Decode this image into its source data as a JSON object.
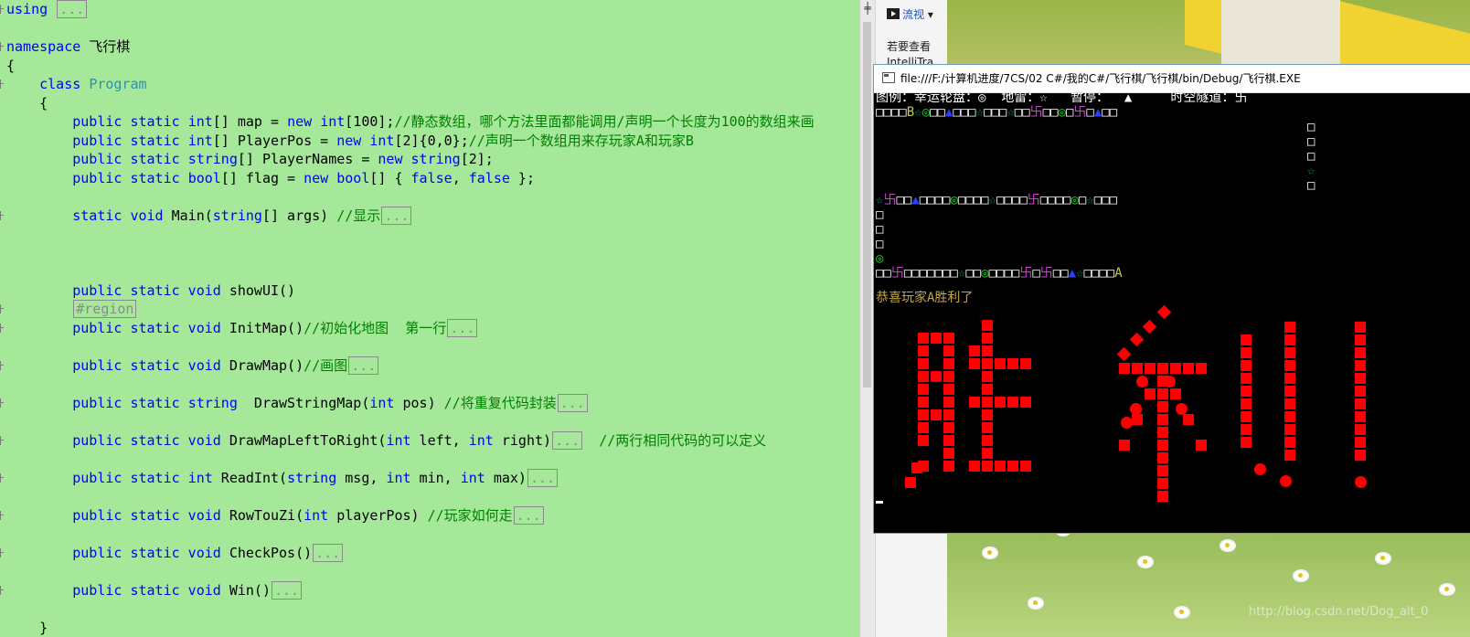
{
  "editor": {
    "lines": [
      {
        "parts": [
          {
            "t": "using",
            "c": "kw"
          },
          {
            "t": " "
          },
          {
            "t": "...",
            "c": "fold"
          }
        ]
      },
      {
        "parts": []
      },
      {
        "parts": [
          {
            "t": "namespace",
            "c": "kw"
          },
          {
            "t": " 飞行棋"
          }
        ]
      },
      {
        "parts": [
          {
            "t": "{"
          }
        ]
      },
      {
        "parts": [
          {
            "t": "    "
          },
          {
            "t": "class",
            "c": "kw"
          },
          {
            "t": " "
          },
          {
            "t": "Program",
            "c": "ty"
          }
        ]
      },
      {
        "parts": [
          {
            "t": "    {"
          }
        ]
      },
      {
        "parts": [
          {
            "t": "        "
          },
          {
            "t": "public static ",
            "c": "kw"
          },
          {
            "t": "int",
            "c": "kw"
          },
          {
            "t": "[] map = "
          },
          {
            "t": "new",
            "c": "kw"
          },
          {
            "t": " "
          },
          {
            "t": "int",
            "c": "kw"
          },
          {
            "t": "[100];"
          },
          {
            "t": "//静态数组，哪个方法里面都能调用/声明一个长度为100的数组来画",
            "c": "cm"
          }
        ]
      },
      {
        "parts": [
          {
            "t": "        "
          },
          {
            "t": "public static ",
            "c": "kw"
          },
          {
            "t": "int",
            "c": "kw"
          },
          {
            "t": "[] PlayerPos = "
          },
          {
            "t": "new",
            "c": "kw"
          },
          {
            "t": " "
          },
          {
            "t": "int",
            "c": "kw"
          },
          {
            "t": "[2]{0,0};"
          },
          {
            "t": "//声明一个数组用来存玩家A和玩家B",
            "c": "cm"
          }
        ]
      },
      {
        "parts": [
          {
            "t": "        "
          },
          {
            "t": "public static ",
            "c": "kw"
          },
          {
            "t": "string",
            "c": "kw"
          },
          {
            "t": "[] PlayerNames = "
          },
          {
            "t": "new",
            "c": "kw"
          },
          {
            "t": " "
          },
          {
            "t": "string",
            "c": "kw"
          },
          {
            "t": "[2];"
          }
        ]
      },
      {
        "parts": [
          {
            "t": "        "
          },
          {
            "t": "public static ",
            "c": "kw"
          },
          {
            "t": "bool",
            "c": "kw"
          },
          {
            "t": "[] flag = "
          },
          {
            "t": "new",
            "c": "kw"
          },
          {
            "t": " "
          },
          {
            "t": "bool",
            "c": "kw"
          },
          {
            "t": "[] { "
          },
          {
            "t": "false",
            "c": "kw"
          },
          {
            "t": ", "
          },
          {
            "t": "false",
            "c": "kw"
          },
          {
            "t": " };"
          }
        ]
      },
      {
        "parts": []
      },
      {
        "parts": [
          {
            "t": "        "
          },
          {
            "t": "static void",
            "c": "kw"
          },
          {
            "t": " Main("
          },
          {
            "t": "string",
            "c": "kw"
          },
          {
            "t": "[] args) "
          },
          {
            "t": "//显示",
            "c": "cm"
          },
          {
            "t": "...",
            "c": "fold"
          }
        ]
      },
      {
        "parts": []
      },
      {
        "parts": []
      },
      {
        "parts": []
      },
      {
        "parts": [
          {
            "t": "        "
          },
          {
            "t": "public static void",
            "c": "kw"
          },
          {
            "t": " showUI()"
          }
        ]
      },
      {
        "parts": [
          {
            "t": "        "
          },
          {
            "t": "#region",
            "c": "fold"
          }
        ]
      },
      {
        "parts": [
          {
            "t": "        "
          },
          {
            "t": "public static void",
            "c": "kw"
          },
          {
            "t": " InitMap()"
          },
          {
            "t": "//初始化地图  第一行",
            "c": "cm"
          },
          {
            "t": "...",
            "c": "fold"
          }
        ]
      },
      {
        "parts": []
      },
      {
        "parts": [
          {
            "t": "        "
          },
          {
            "t": "public static void",
            "c": "kw"
          },
          {
            "t": " DrawMap()"
          },
          {
            "t": "//画图",
            "c": "cm"
          },
          {
            "t": "...",
            "c": "fold"
          }
        ]
      },
      {
        "parts": []
      },
      {
        "parts": [
          {
            "t": "        "
          },
          {
            "t": "public static ",
            "c": "kw"
          },
          {
            "t": "string",
            "c": "kw"
          },
          {
            "t": "  DrawStringMap("
          },
          {
            "t": "int",
            "c": "kw"
          },
          {
            "t": " pos) "
          },
          {
            "t": "//将重复代码封装",
            "c": "cm"
          },
          {
            "t": "...",
            "c": "fold"
          }
        ]
      },
      {
        "parts": []
      },
      {
        "parts": [
          {
            "t": "        "
          },
          {
            "t": "public static void",
            "c": "kw"
          },
          {
            "t": " DrawMapLeftToRight("
          },
          {
            "t": "int",
            "c": "kw"
          },
          {
            "t": " left, "
          },
          {
            "t": "int",
            "c": "kw"
          },
          {
            "t": " right)"
          },
          {
            "t": "...",
            "c": "fold"
          },
          {
            "t": "  "
          },
          {
            "t": "//两行相同代码的可以定义",
            "c": "cm"
          }
        ]
      },
      {
        "parts": []
      },
      {
        "parts": [
          {
            "t": "        "
          },
          {
            "t": "public static ",
            "c": "kw"
          },
          {
            "t": "int",
            "c": "kw"
          },
          {
            "t": " ReadInt("
          },
          {
            "t": "string",
            "c": "kw"
          },
          {
            "t": " msg, "
          },
          {
            "t": "int",
            "c": "kw"
          },
          {
            "t": " min, "
          },
          {
            "t": "int",
            "c": "kw"
          },
          {
            "t": " max)"
          },
          {
            "t": "...",
            "c": "fold"
          }
        ]
      },
      {
        "parts": []
      },
      {
        "parts": [
          {
            "t": "        "
          },
          {
            "t": "public static void",
            "c": "kw"
          },
          {
            "t": " RowTouZi("
          },
          {
            "t": "int",
            "c": "kw"
          },
          {
            "t": " playerPos) "
          },
          {
            "t": "//玩家如何走",
            "c": "cm"
          },
          {
            "t": "...",
            "c": "fold"
          }
        ]
      },
      {
        "parts": []
      },
      {
        "parts": [
          {
            "t": "        "
          },
          {
            "t": "public static void",
            "c": "kw"
          },
          {
            "t": " CheckPos()"
          },
          {
            "t": "...",
            "c": "fold"
          }
        ]
      },
      {
        "parts": []
      },
      {
        "parts": [
          {
            "t": "        "
          },
          {
            "t": "public static void",
            "c": "kw"
          },
          {
            "t": " Win()"
          },
          {
            "t": "...",
            "c": "fold"
          }
        ]
      },
      {
        "parts": []
      },
      {
        "parts": [
          {
            "t": "    }"
          }
        ]
      }
    ]
  },
  "side_panel": {
    "stream_button": "流视",
    "hint_text": "若要查看",
    "hint_text2": "IntelliTra"
  },
  "console": {
    "title": "file:///F:/计算机进度/7CS/02 C#/我的C#/飞行棋/飞行棋/bin/Debug/飞行棋.EXE",
    "legend": "图例：幸运轮盘：◎  地雷：☆   暂停：  ▲     时空隧道：卐",
    "map_rows": [
      {
        "parts": [
          {
            "t": "□□□□",
            "c": "w"
          },
          {
            "t": "B",
            "c": "y"
          },
          {
            "t": "☆",
            "c": "c"
          },
          {
            "t": "◎",
            "c": "g"
          },
          {
            "t": "□□",
            "c": "w"
          },
          {
            "t": "▲",
            "c": "b"
          },
          {
            "t": "□□□",
            "c": "w"
          },
          {
            "t": "☆",
            "c": "c"
          },
          {
            "t": "□□□",
            "c": "w"
          },
          {
            "t": "☆",
            "c": "c"
          },
          {
            "t": "□□",
            "c": "w"
          },
          {
            "t": "卐",
            "c": "m"
          },
          {
            "t": "□□",
            "c": "w"
          },
          {
            "t": "◎",
            "c": "g"
          },
          {
            "t": "□",
            "c": "w"
          },
          {
            "t": "卐",
            "c": "m"
          },
          {
            "t": "□",
            "c": "w"
          },
          {
            "t": "▲",
            "c": "b"
          },
          {
            "t": "□□",
            "c": "w"
          }
        ]
      },
      {
        "parts": [
          {
            "t": "                                                        □",
            "c": "w"
          }
        ]
      },
      {
        "parts": [
          {
            "t": "                                                        □",
            "c": "w"
          }
        ]
      },
      {
        "parts": [
          {
            "t": "                                                        □",
            "c": "w"
          }
        ]
      },
      {
        "parts": [
          {
            "t": "                                                        ",
            "c": "w"
          },
          {
            "t": "☆",
            "c": "c"
          }
        ]
      },
      {
        "parts": [
          {
            "t": "                                                        □",
            "c": "w"
          }
        ]
      },
      {
        "parts": [
          {
            "t": "☆",
            "c": "c"
          },
          {
            "t": "卐",
            "c": "m"
          },
          {
            "t": "□□",
            "c": "w"
          },
          {
            "t": "▲",
            "c": "b"
          },
          {
            "t": "□□□□",
            "c": "w"
          },
          {
            "t": "◎",
            "c": "g"
          },
          {
            "t": "□□□□",
            "c": "w"
          },
          {
            "t": "☆",
            "c": "c"
          },
          {
            "t": "□□□□",
            "c": "w"
          },
          {
            "t": "卐",
            "c": "m"
          },
          {
            "t": "□□□□",
            "c": "w"
          },
          {
            "t": "◎",
            "c": "g"
          },
          {
            "t": "□",
            "c": "w"
          },
          {
            "t": "☆",
            "c": "c"
          },
          {
            "t": "□□□",
            "c": "w"
          }
        ]
      },
      {
        "parts": [
          {
            "t": "□",
            "c": "w"
          }
        ]
      },
      {
        "parts": [
          {
            "t": "□",
            "c": "w"
          }
        ]
      },
      {
        "parts": [
          {
            "t": "□",
            "c": "w"
          }
        ]
      },
      {
        "parts": [
          {
            "t": "◎",
            "c": "g"
          }
        ]
      },
      {
        "parts": [
          {
            "t": "□□",
            "c": "w"
          },
          {
            "t": "卐",
            "c": "m"
          },
          {
            "t": "□□□□□□□",
            "c": "w"
          },
          {
            "t": "☆",
            "c": "c"
          },
          {
            "t": "□□",
            "c": "w"
          },
          {
            "t": "◎",
            "c": "g"
          },
          {
            "t": "□□□□",
            "c": "w"
          },
          {
            "t": "卐",
            "c": "m"
          },
          {
            "t": "□",
            "c": "w"
          },
          {
            "t": "卐",
            "c": "m"
          },
          {
            "t": "□□",
            "c": "w"
          },
          {
            "t": "▲",
            "c": "b"
          },
          {
            "t": "☆",
            "c": "c"
          },
          {
            "t": "□□□□",
            "c": "w"
          },
          {
            "t": "A",
            "c": "y"
          }
        ]
      }
    ],
    "message": "恭喜玩家A胜利了",
    "banner_color": "#ff0000"
  },
  "watermark": "http://blog.csdn.net/Dog_alt_0"
}
